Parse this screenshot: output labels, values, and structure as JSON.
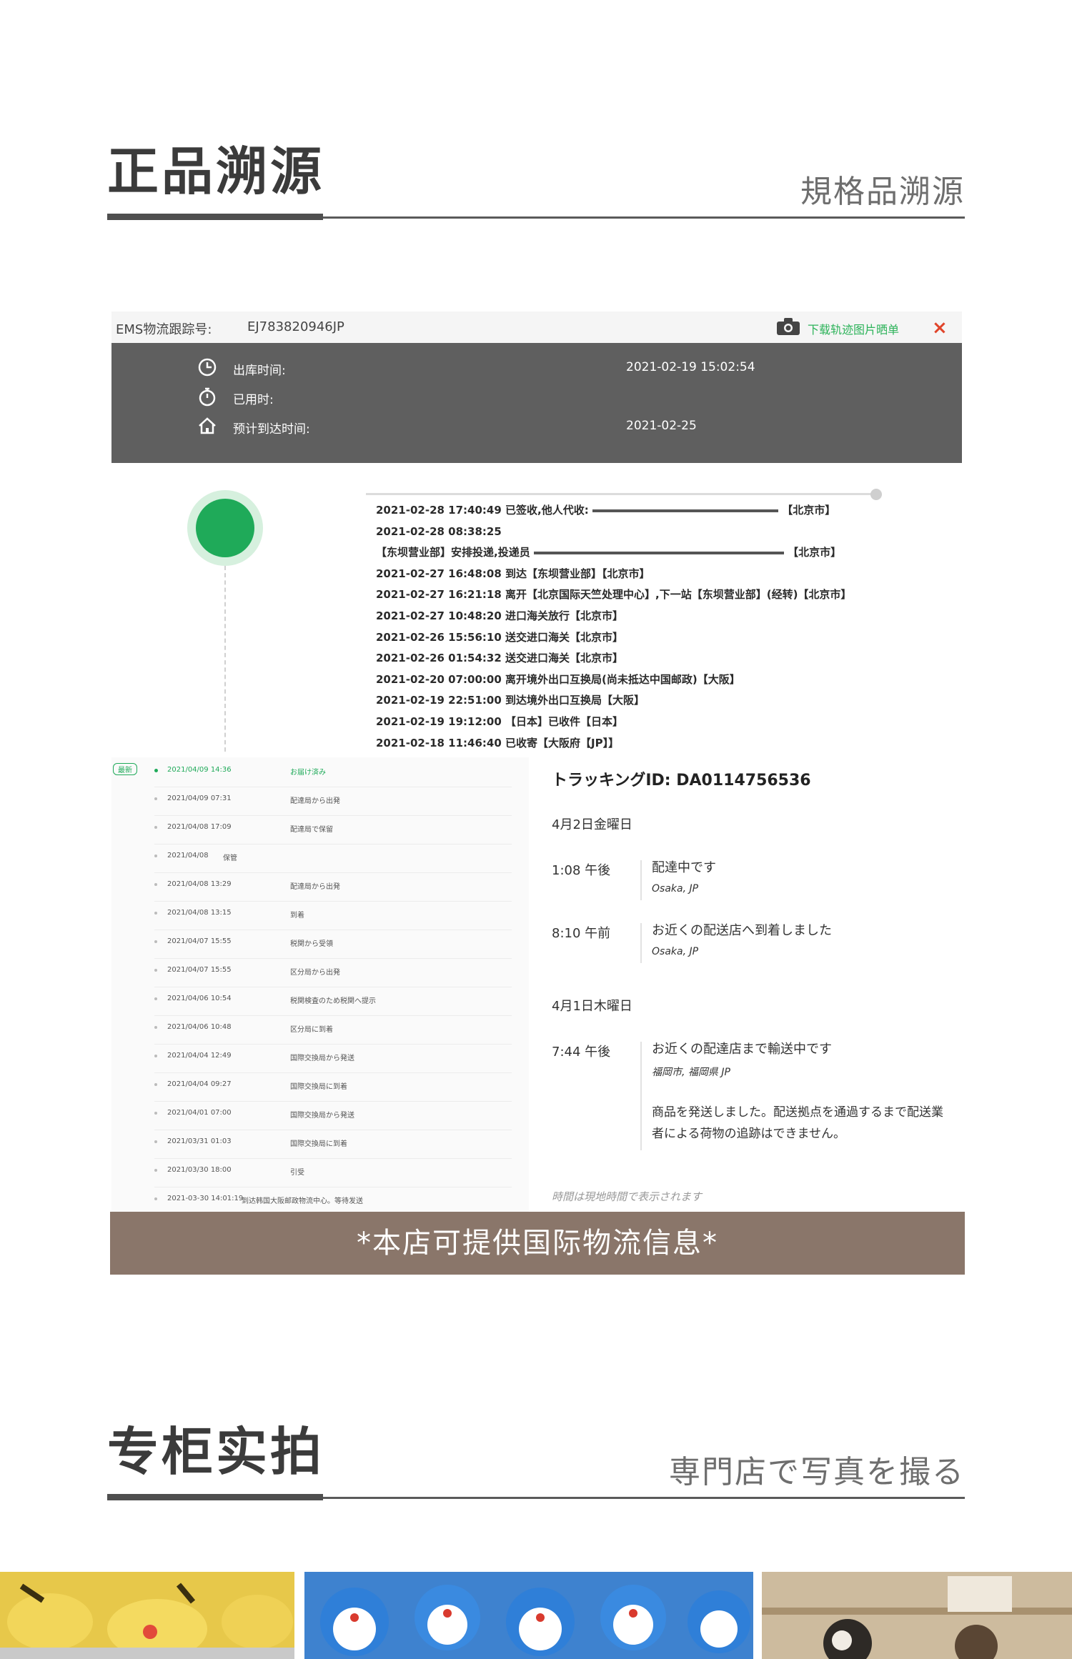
{
  "section1": {
    "title": "正品溯源",
    "subtitle": "規格品溯源"
  },
  "ems": {
    "tracking_label": "EMS物流跟踪号:",
    "tracking_number": "EJ783820946JP",
    "download_label": "下载轨迹图片晒单",
    "close_symbol": "×",
    "rows": [
      {
        "icon": "clock-icon",
        "key": "出库时间:",
        "value": "2021-02-19 15:02:54"
      },
      {
        "icon": "stopwatch-icon",
        "key": "已用时:",
        "value": ""
      },
      {
        "icon": "home-icon",
        "key": "预计到达时间:",
        "value": "2021-02-25"
      }
    ]
  },
  "timeline": [
    "2021-02-28 17:40:49  已签收,他人代收:",
    "2021-02-28 08:38:25",
    "【东坝营业部】安排投递,投递员",
    "2021-02-27 16:48:08  到达【东坝营业部】【北京市】",
    "2021-02-27 16:21:18  离开【北京国际天竺处理中心】,下一站【东坝营业部】(经转)【北京市】",
    "2021-02-27 10:48:20  进口海关放行【北京市】",
    "2021-02-26 15:56:10  送交进口海关【北京市】",
    "2021-02-26 01:54:32  送交进口海关【北京市】",
    "2021-02-20 07:00:00  离开境外出口互换局(尚未抵达中国邮政)【大阪】",
    "2021-02-19 22:51:00  到达境外出口互换局【大阪】",
    "2021-02-19 19:12:00  【日本】已收件【日本】",
    "2021-02-18 11:46:40  已收寄【大阪府【JP】】"
  ],
  "timeline_suffix": {
    "item0": "【北京市】",
    "item2": "【北京市】"
  },
  "jp_list": {
    "badge": "最新",
    "items": [
      {
        "time": "2021/04/09 14:36",
        "desc": "お届け済み"
      },
      {
        "time": "2021/04/09 07:31",
        "desc": "配達局から出発"
      },
      {
        "time": "2021/04/08 17:09",
        "desc": "配達局で保留"
      },
      {
        "time": "2021/04/08",
        "desc": "保管"
      },
      {
        "time": "2021/04/08 13:29",
        "desc": "配達局から出発"
      },
      {
        "time": "2021/04/08 13:15",
        "desc": "到着"
      },
      {
        "time": "2021/04/07 15:55",
        "desc": "税関から受領"
      },
      {
        "time": "2021/04/07 15:55",
        "desc": "区分局から出発"
      },
      {
        "time": "2021/04/06 10:54",
        "desc": "税関検査のため税関へ提示"
      },
      {
        "time": "2021/04/06 10:48",
        "desc": "区分局に到着"
      },
      {
        "time": "2021/04/04 12:49",
        "desc": "国際交換局から発送"
      },
      {
        "time": "2021/04/04 09:27",
        "desc": "国際交換局に到着"
      },
      {
        "time": "2021/04/01 07:00",
        "desc": "国際交換局から発送"
      },
      {
        "time": "2021/03/31 01:03",
        "desc": "国際交換局に到着"
      },
      {
        "time": "2021/03/30 18:00",
        "desc": "引受"
      },
      {
        "time": "2021-03-30 14:01:19",
        "desc": "到达韩国大阪邮政物流中心。等待发送"
      }
    ]
  },
  "jp_card": {
    "tracking_id": "トラッキングID: DA0114756536",
    "date1": "4月2日金曜日",
    "entries1": [
      {
        "time": "1:08 午後",
        "status": "配達中です",
        "location": "Osaka, JP"
      },
      {
        "time": "8:10 午前",
        "status": "お近くの配送店へ到着しました",
        "location": "Osaka, JP"
      }
    ],
    "date2": "4月1日木曜日",
    "entries2": [
      {
        "time": "7:44 午後",
        "status": "お近くの配達店まで輸送中です",
        "location": "福岡市, 福岡県 JP"
      },
      {
        "time": "",
        "status": "商品を発送しました。配送拠点を通過するまで配送業者による荷物の追跡はできません。",
        "location": ""
      }
    ],
    "note": "時間は現地時間で表示されます"
  },
  "banner": "*本店可提供国际物流信息*",
  "section2": {
    "title": "专柜实拍",
    "subtitle": "専門店で写真を撮る"
  },
  "colors": {
    "accent_green": "#1faa59",
    "banner_brown": "#8a766a",
    "dark_panel": "#5f5f5f",
    "close_red": "#e0442a"
  }
}
